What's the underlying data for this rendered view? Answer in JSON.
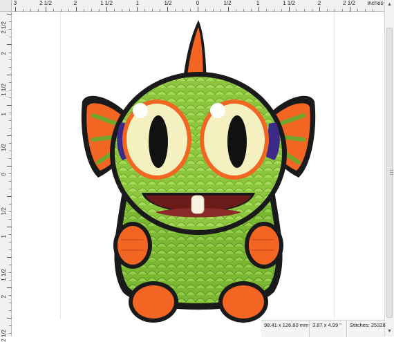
{
  "ruler": {
    "top_labels": [
      "3",
      "2 1/2",
      "2",
      "1 1/2",
      "1",
      "1/2",
      "0",
      "1/2",
      "1",
      "1 1/2",
      "2",
      "2 1/2"
    ],
    "units_label": "inches",
    "left_labels": [
      "2 1/2",
      "2",
      "1 1/2",
      "1",
      "1/2",
      "0",
      "1/2",
      "1",
      "1 1/2",
      "2",
      "2 1/2"
    ]
  },
  "status": {
    "size_mm": "98.41 x 126.80 mm",
    "size_in": "3.87 x 4.99 \"",
    "stitches": "Stitches: 25328"
  },
  "design": {
    "name_icon": "fish-monster-embroidery-icon",
    "colors": {
      "body": "#8cc63f",
      "outline": "#1a1a1a",
      "fin": "#f26522",
      "eye_white": "#f4f0c0",
      "pupil": "#111111",
      "mouth": "#6b1a1a",
      "cheek": "#3b2a88"
    }
  }
}
